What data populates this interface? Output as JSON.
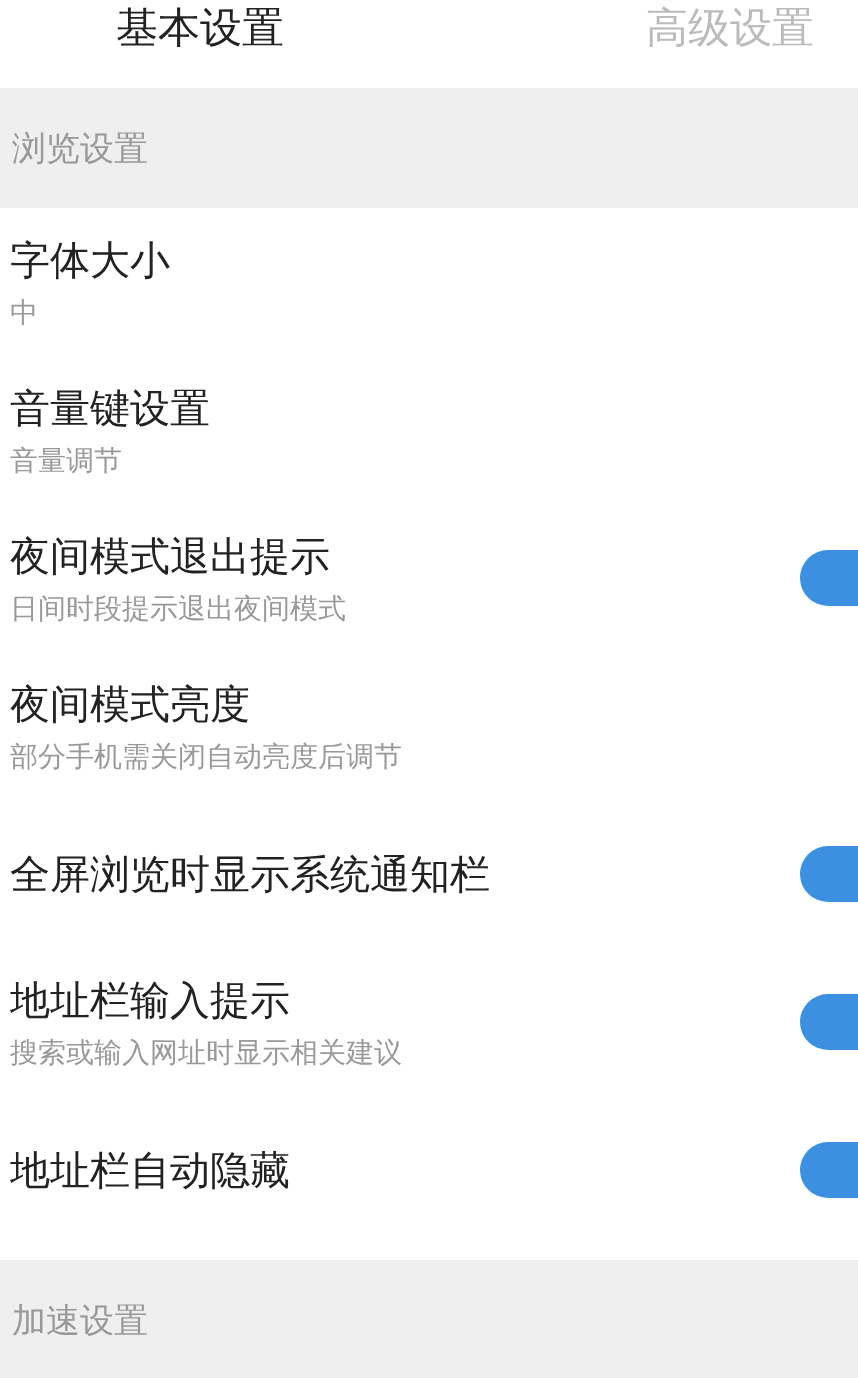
{
  "tabs": [
    {
      "label": "基本设置",
      "selected": true
    },
    {
      "label": "高级设置",
      "selected": false
    }
  ],
  "sections": [
    {
      "title": "浏览设置",
      "items": [
        {
          "kind": "option",
          "title": "字体大小",
          "subtitle": "中"
        },
        {
          "kind": "option",
          "title": "音量键设置",
          "subtitle": "音量调节"
        },
        {
          "kind": "toggle",
          "title": "夜间模式退出提示",
          "subtitle": "日间时段提示退出夜间模式",
          "on": true
        },
        {
          "kind": "option",
          "title": "夜间模式亮度",
          "subtitle": "部分手机需关闭自动亮度后调节"
        },
        {
          "kind": "toggle",
          "title": "全屏浏览时显示系统通知栏",
          "on": true
        },
        {
          "kind": "toggle",
          "title": "地址栏输入提示",
          "subtitle": "搜索或输入网址时显示相关建议",
          "on": true
        },
        {
          "kind": "toggle",
          "title": "地址栏自动隐藏",
          "on": true
        }
      ]
    },
    {
      "title": "加速设置"
    }
  ]
}
